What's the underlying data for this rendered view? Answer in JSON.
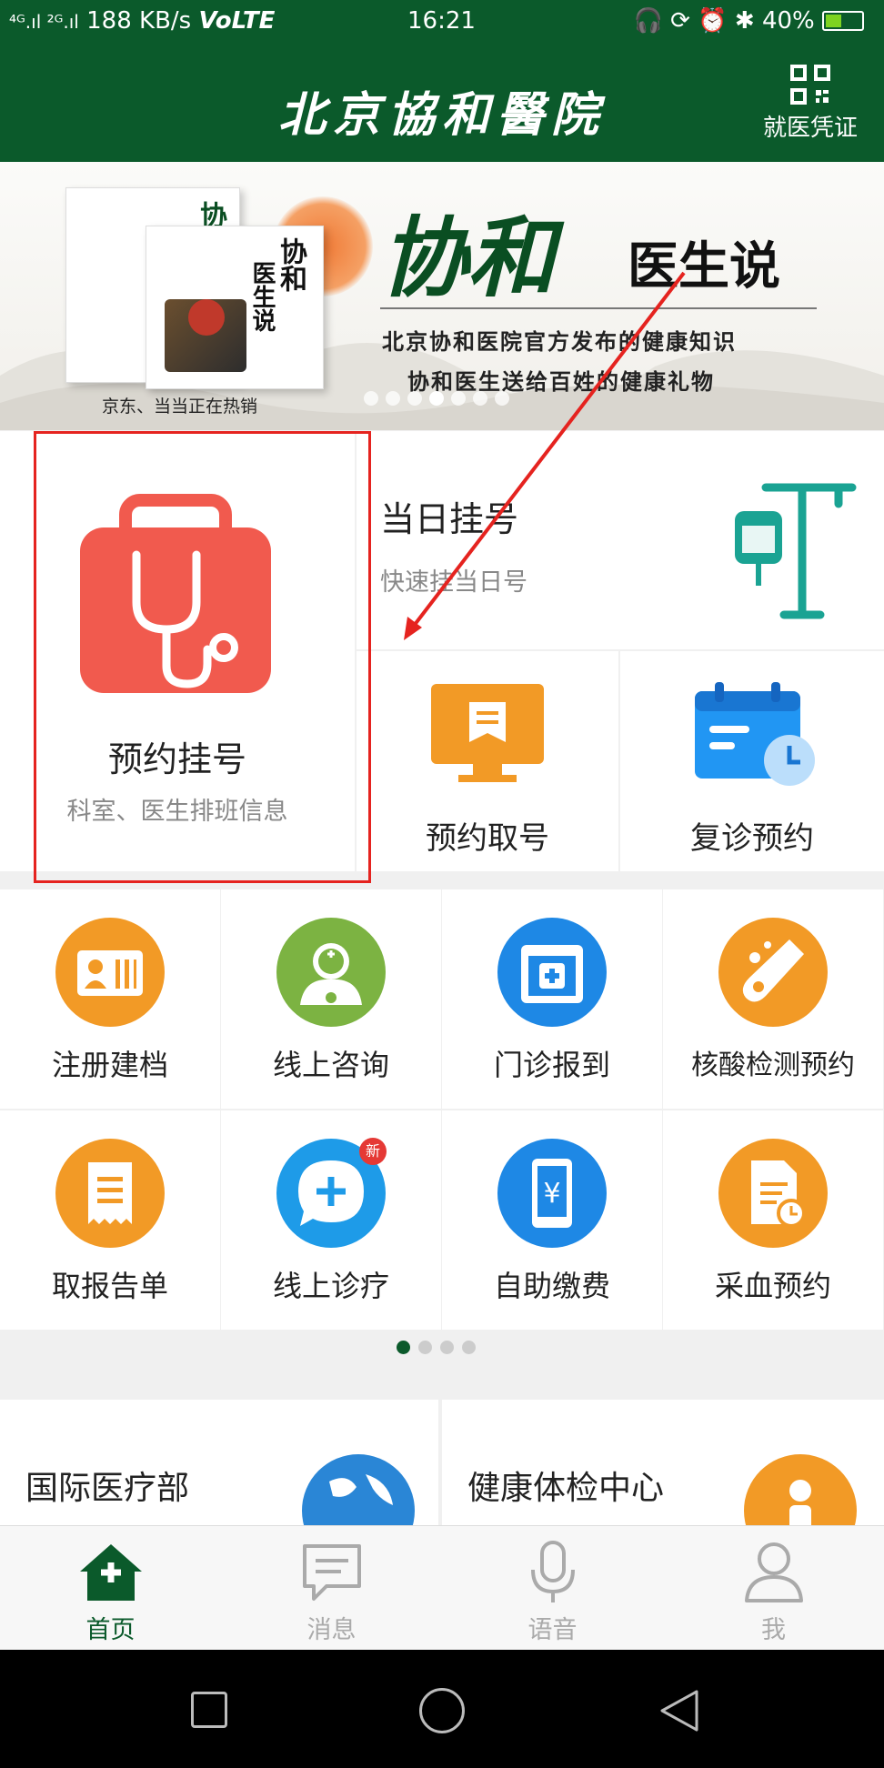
{
  "status_bar": {
    "signal": "⁴ᴳ.ıl ²ᴳ.ıl",
    "speed": "188 KB/s",
    "volte": "VoLTE",
    "time": "16:21",
    "battery": "40%"
  },
  "header": {
    "title": "北京協和醫院",
    "qr_label": "就医凭证"
  },
  "banner": {
    "brand": "协和",
    "brand_suffix": "医生说",
    "line1": "北京协和医院官方发布的健康知识",
    "line2": "协和医生送给百姓的健康礼物",
    "caption": "京东、当当正在热销",
    "book_title": "医生说"
  },
  "services": {
    "appointment": {
      "title": "预约挂号",
      "subtitle": "科室、医生排班信息"
    },
    "same_day": {
      "title": "当日挂号",
      "subtitle": "快速挂当日号"
    },
    "take_number": {
      "title": "预约取号"
    },
    "revisit": {
      "title": "复诊预约"
    }
  },
  "grid": [
    {
      "label": "注册建档",
      "icon": "id-card-icon",
      "color": "#f29a26"
    },
    {
      "label": "线上咨询",
      "icon": "doctor-icon",
      "color": "#7cb342"
    },
    {
      "label": "门诊报到",
      "icon": "calendar-plus-icon",
      "color": "#1e88e5"
    },
    {
      "label": "核酸检测预约",
      "icon": "test-tube-icon",
      "color": "#f29a26"
    },
    {
      "label": "取报告单",
      "icon": "receipt-icon",
      "color": "#f29a26"
    },
    {
      "label": "线上诊疗",
      "icon": "chat-plus-icon",
      "color": "#1e9be8",
      "badge": "新"
    },
    {
      "label": "自助缴费",
      "icon": "phone-yuan-icon",
      "color": "#1e88e5"
    },
    {
      "label": "采血预约",
      "icon": "document-clock-icon",
      "color": "#f29a26"
    }
  ],
  "bottom_cards": {
    "left": "国际医疗部",
    "right": "健康体检中心"
  },
  "tabs": [
    {
      "label": "首页",
      "active": true
    },
    {
      "label": "消息",
      "active": false
    },
    {
      "label": "语音",
      "active": false
    },
    {
      "label": "我",
      "active": false
    }
  ]
}
